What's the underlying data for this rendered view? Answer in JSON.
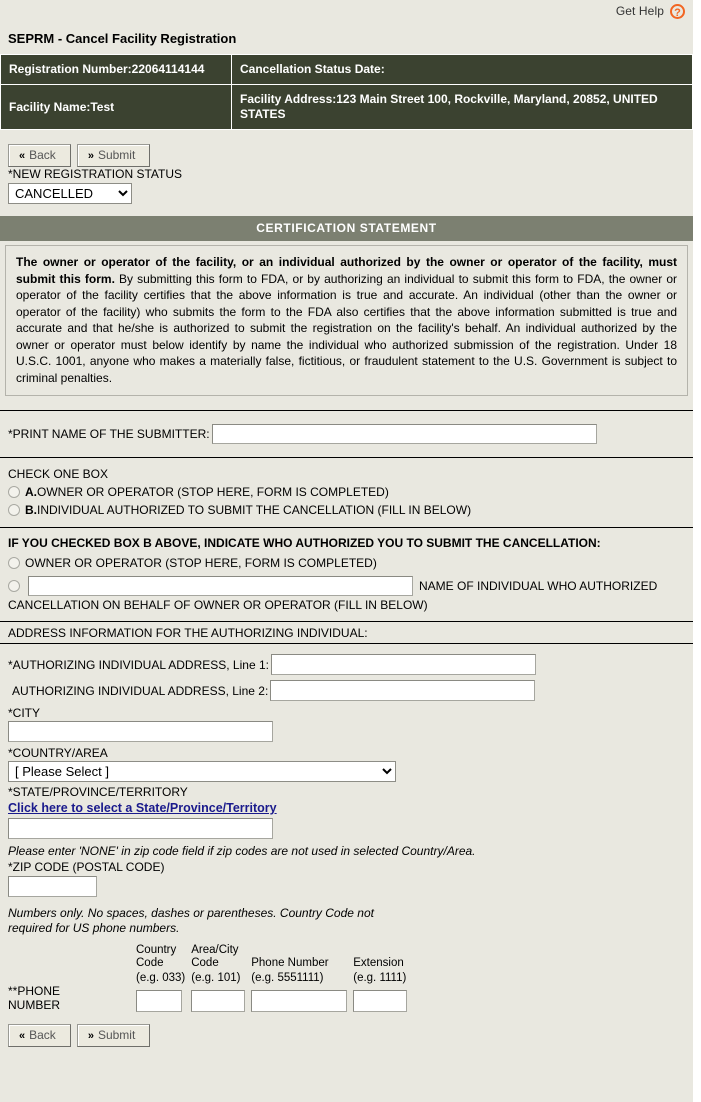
{
  "help": {
    "label": "Get Help",
    "icon": "?"
  },
  "page_title": "SEPRM - Cancel Facility Registration",
  "registration": {
    "number_label": "Registration Number:22064114144",
    "cancellation_status_label": "Cancellation Status Date:",
    "facility_name_label": "Facility Name:Test",
    "facility_address_label": "Facility Address:123 Main Street 100, Rockville, Maryland, 20852, UNITED STATES"
  },
  "toolbar": {
    "back_label": "Back",
    "submit_label": "Submit",
    "back_chevron": "«",
    "submit_chevron": "»"
  },
  "status": {
    "label": "*NEW REGISTRATION STATUS",
    "selected": "CANCELLED",
    "options": [
      "CANCELLED"
    ]
  },
  "certification": {
    "header": "CERTIFICATION STATEMENT",
    "bold_lead": "The owner or operator of the facility, or an individual authorized by the owner or operator of the facility, must submit this form.",
    "body": " By submitting this form to FDA, or by authorizing an individual to submit this form to FDA, the owner or operator of the facility certifies that the above information is true and accurate. An individual (other than the owner or operator of the facility) who submits the form to the FDA also certifies that the above information submitted is true and accurate and that he/she is authorized to submit the registration on the facility's behalf. An individual authorized by the owner or operator must below identify by name the individual who authorized submission of the registration. Under 18 U.S.C. 1001, anyone who makes a materially false, fictitious, or fraudulent statement to the U.S. Government is subject to criminal penalties."
  },
  "submitter": {
    "label": "*PRINT NAME OF THE SUBMITTER:",
    "value": "",
    "placeholder": ""
  },
  "check_one": {
    "title": "CHECK ONE BOX",
    "option_a_bold": "A.",
    "option_a_text": "OWNER OR OPERATOR (STOP HERE, FORM IS COMPLETED)",
    "option_b_bold": "B.",
    "option_b_text": "INDIVIDUAL AUTHORIZED TO SUBMIT THE CANCELLATION (FILL IN BELOW)"
  },
  "box_b": {
    "title": "IF YOU CHECKED BOX B ABOVE, INDICATE WHO AUTHORIZED YOU TO SUBMIT THE CANCELLATION:",
    "option_owner": "OWNER OR OPERATOR (STOP HERE, FORM IS COMPLETED)",
    "name_input_value": "",
    "name_after_text": "NAME OF INDIVIDUAL WHO AUTHORIZED",
    "name_second_line": "CANCELLATION ON BEHALF OF OWNER OR OPERATOR (FILL IN BELOW)"
  },
  "address": {
    "section_title": "ADDRESS INFORMATION FOR THE AUTHORIZING INDIVIDUAL:",
    "line1_label": "*AUTHORIZING INDIVIDUAL ADDRESS, Line 1:",
    "line1_value": "",
    "line2_label": "AUTHORIZING INDIVIDUAL ADDRESS, Line 2:",
    "line2_value": "",
    "city_label": "*CITY",
    "city_value": "",
    "country_label": "*COUNTRY/AREA",
    "country_selected": "[ Please Select ]",
    "country_options": [
      "[ Please Select ]"
    ],
    "state_label": "*STATE/PROVINCE/TERRITORY",
    "state_link": "Click here to select a State/Province/Territory",
    "state_value": "",
    "zip_note": "Please enter 'NONE' in zip code field if zip codes are not used in selected Country/Area.",
    "zip_label": "*ZIP CODE (POSTAL CODE)",
    "zip_value": ""
  },
  "phone": {
    "note_line1": "Numbers only. No spaces, dashes or parentheses. Country Code not",
    "note_line2": "required for US phone numbers.",
    "label_line1": "**PHONE",
    "label_line2": "NUMBER",
    "headers": [
      {
        "title_line1": "Country",
        "title_line2": "Code",
        "example": "(e.g. 033)",
        "value": ""
      },
      {
        "title_line1": "Area/City",
        "title_line2": "Code",
        "example": "(e.g. 101)",
        "value": ""
      },
      {
        "title_line1": "Phone Number",
        "title_line2": "",
        "example": "(e.g. 5551111)",
        "value": ""
      },
      {
        "title_line1": "Extension",
        "title_line2": "",
        "example": "(e.g. 1111)",
        "value": ""
      }
    ]
  },
  "colors": {
    "page_bg": "#e9e8e0",
    "table_header_green": "#3b4230",
    "cert_header_gray": "#7c8071",
    "link_blue": "#1a1a8c",
    "help_orange": "#f26522"
  }
}
